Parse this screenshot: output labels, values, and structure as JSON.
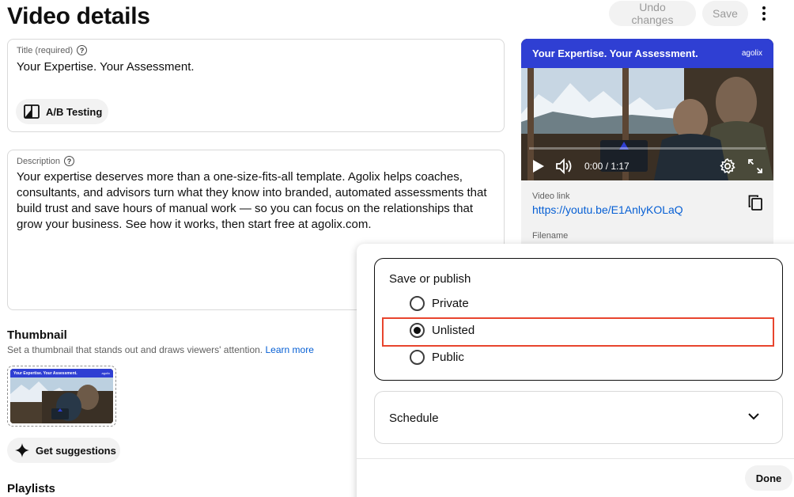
{
  "header": {
    "title": "Video details",
    "undo_label": "Undo changes",
    "save_label": "Save"
  },
  "title_field": {
    "label": "Title (required)",
    "value": "Your Expertise. Your Assessment."
  },
  "ab_testing_label": "A/B Testing",
  "description_field": {
    "label": "Description",
    "value": "Your expertise deserves more than a one-size-fits-all template. Agolix helps coaches, consultants, and advisors turn what they know into branded, automated assessments that build trust and save hours of manual work — so you can focus on the relationships that grow your business. See how it works, then start free at agolix.com."
  },
  "thumbnail": {
    "heading": "Thumbnail",
    "subtitle": "Set a thumbnail that stands out and draws viewers' attention.",
    "learn_more": "Learn more",
    "banner_text": "Your Expertise. Your Assessment.",
    "banner_logo": "agolix"
  },
  "suggestions_label": "Get suggestions",
  "playlists_heading": "Playlists",
  "video": {
    "banner_title": "Your Expertise. Your Assessment.",
    "banner_logo": "agolix",
    "time": "0:00 / 1:17",
    "link_label": "Video link",
    "link": "https://youtu.be/E1AnlyKOLaQ",
    "filename_label": "Filename"
  },
  "publish": {
    "heading": "Save or publish",
    "options": [
      "Private",
      "Unlisted",
      "Public"
    ],
    "selected": "Unlisted",
    "schedule_label": "Schedule",
    "done_label": "Done"
  },
  "colors": {
    "accent_link": "#065fd4",
    "banner_blue": "#2f3fd3",
    "highlight_red": "#e8452e"
  }
}
